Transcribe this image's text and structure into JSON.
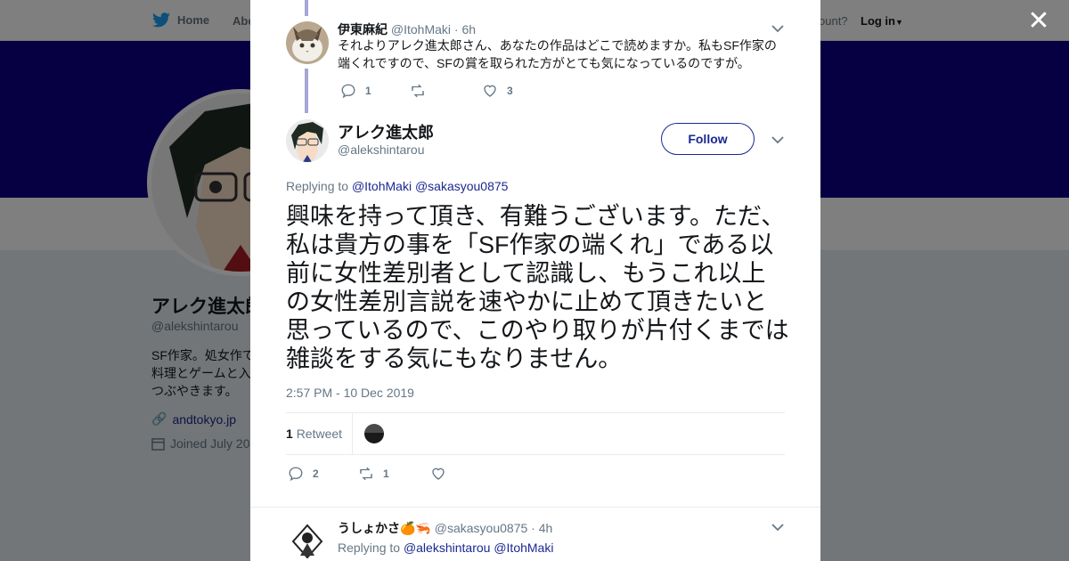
{
  "topbar": {
    "home_label": "Home",
    "about_label": "Abo",
    "account_text": "ccount?",
    "login_label": "Log in"
  },
  "profile": {
    "name": "アレク進太郎",
    "handle": "@alekshintarou",
    "bio": "SF作家。処女作で料理とゲームと入つぶやきます。",
    "link": "andtokyo.jp",
    "joined": "Joined July 20"
  },
  "modal": {
    "prev_tweet": {
      "name": "伊東麻紀",
      "handle": "@ItohMaki",
      "time": "· 6h",
      "text": "それよりアレク進太郎さん、あなたの作品はどこで読めますか。私もSF作家の端くれですので、SFの賞を取られた方がとても気になっているのですが。",
      "reply_count": "1",
      "like_count": "3"
    },
    "main_tweet": {
      "name": "アレク進太郎",
      "handle": "@alekshintarou",
      "follow_label": "Follow",
      "replying_prefix": "Replying to",
      "replying_to_1": "@ItohMaki",
      "replying_to_2": "@sakasyou0875",
      "text": "興味を持って頂き、有難うございます。ただ、私は貴方の事を「SF作家の端くれ」である以前に女性差別者として認識し、もうこれ以上の女性差別言説を速やかに止めて頂きたいと思っているので、このやり取りが片付くまでは雑談をする気にもなりません。",
      "timestamp": "2:57 PM - 10 Dec 2019",
      "retweet_count": "1",
      "retweet_label": "Retweet",
      "reply_count": "2",
      "rt_count_action": "1"
    },
    "next_tweet": {
      "name": "うしょかさ",
      "emoji": "🍊🦐",
      "handle": "@sakasyou0875",
      "time": "· 4h",
      "replying_prefix": "Replying to",
      "replying_to_1": "@alekshintarou",
      "replying_to_2": "@ItohMaki"
    }
  },
  "colors": {
    "accent": "#1b2891",
    "banner": "#0d0084",
    "thread_line": "#a7a6d6"
  }
}
